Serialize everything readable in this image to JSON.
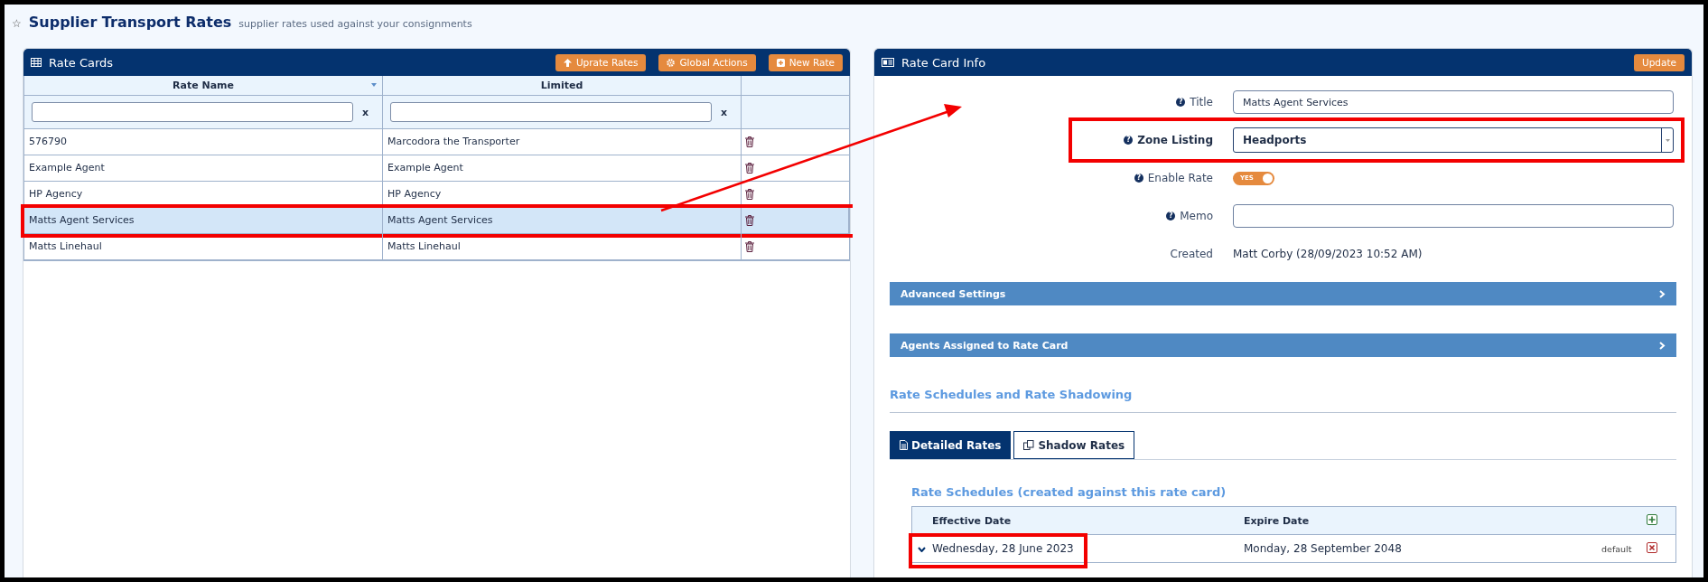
{
  "page": {
    "star": "☆",
    "title": "Supplier Transport Rates",
    "subtitle": "supplier rates used against your consignments"
  },
  "rate_cards": {
    "title": "Rate Cards",
    "buttons": [
      "Uprate Rates",
      "Global Actions",
      "New Rate"
    ],
    "columns": [
      {
        "label": "Rate Name",
        "sortable": true
      },
      {
        "label": "Limited",
        "sortable": false
      }
    ],
    "filter_clear": [
      "x",
      "x"
    ],
    "rows": [
      {
        "cells": [
          "576790",
          "Marcodora the Transporter"
        ],
        "selected": false,
        "highlighted": false
      },
      {
        "cells": [
          "Example Agent",
          "Example Agent"
        ],
        "selected": false,
        "highlighted": false
      },
      {
        "cells": [
          "HP Agency",
          "HP Agency"
        ],
        "selected": false,
        "highlighted": false
      },
      {
        "cells": [
          "Matts Agent Services",
          "Matts Agent Services"
        ],
        "selected": true,
        "highlighted": true
      },
      {
        "cells": [
          "Matts Linehaul",
          "Matts Linehaul"
        ],
        "selected": false,
        "highlighted": false
      }
    ]
  },
  "rate_card_info": {
    "title": "Rate Card Info",
    "button": "Update",
    "fields": [
      {
        "kind": "text",
        "label": "Title",
        "help": "?",
        "required": false,
        "value": "Matts Agent Services",
        "highlighted": false
      },
      {
        "kind": "select",
        "label": "Zone Listing",
        "help": "?",
        "required": true,
        "value": "Headports",
        "highlighted": true
      },
      {
        "kind": "toggle",
        "label": "Enable Rate",
        "help": "?",
        "required": false,
        "on": true,
        "text": "YES",
        "highlighted": false
      },
      {
        "kind": "text",
        "label": "Memo",
        "help": "?",
        "required": false,
        "highlighted": false
      },
      {
        "kind": "static",
        "label": "Created",
        "required": false,
        "value": "Matt Corby (28/09/2023 10:52 AM)",
        "highlighted": false
      }
    ],
    "sections": [
      {
        "title": "Advanced Settings",
        "expanded": false
      },
      {
        "title": "Agents Assigned to Rate Card",
        "expanded": false
      }
    ],
    "schedules_heading": "Rate Schedules and Rate Shadowing",
    "tabs": [
      {
        "label": "Detailed Rates",
        "selected": true
      },
      {
        "label": "Shadow Rates",
        "selected": false
      }
    ],
    "schedule_table": {
      "title": "Rate Schedules (created against this rate card)",
      "columns": [
        "Effective Date",
        "Expire Date"
      ],
      "rows": [
        {
          "effective": "Wednesday, 28 June 2023",
          "expire": "Monday, 28 September 2048",
          "tag": "default",
          "expanded": false,
          "highlighted": true
        }
      ]
    }
  }
}
